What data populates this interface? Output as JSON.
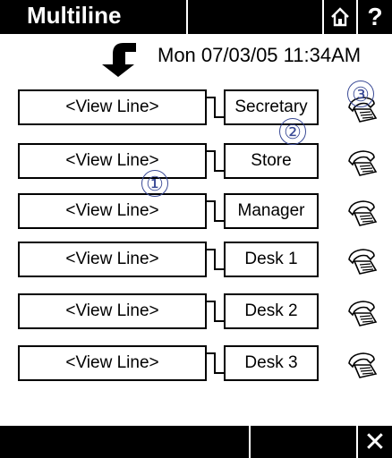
{
  "header": {
    "title": "Multiline",
    "home_icon": "home-icon",
    "help_label": "?"
  },
  "datetime": "Mon 07/03/05 11:34AM",
  "back_icon": "back-arrow-icon",
  "lines": [
    {
      "view": "<View Line>",
      "label": "Secretary"
    },
    {
      "view": "<View Line>",
      "label": "Store"
    },
    {
      "view": "<View Line>",
      "label": "Manager"
    },
    {
      "view": "<View Line>",
      "label": "Desk 1"
    },
    {
      "view": "<View Line>",
      "label": "Desk 2"
    },
    {
      "view": "<View Line>",
      "label": "Desk 3"
    }
  ],
  "phone_icon": "phone-icon",
  "callouts": [
    "①",
    "②",
    "③"
  ],
  "footer": {
    "close_label": "✕"
  }
}
